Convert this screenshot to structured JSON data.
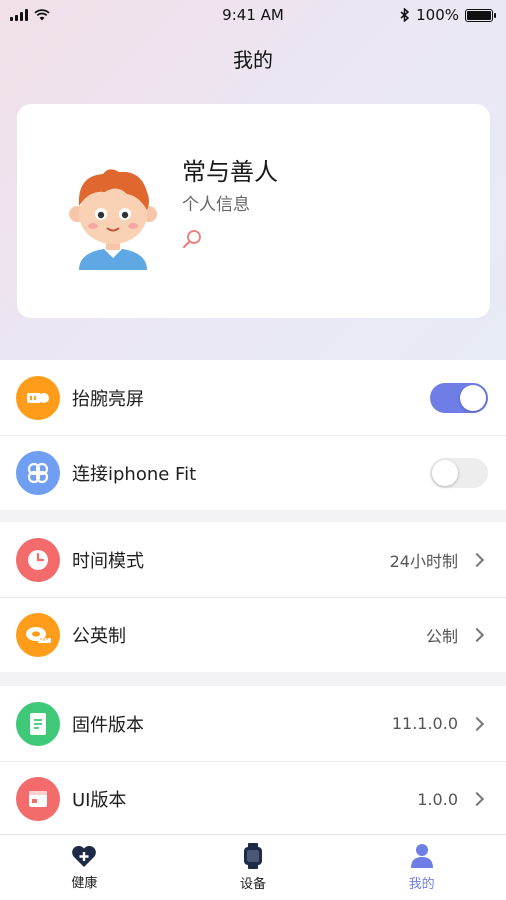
{
  "status_bar": {
    "time": "9:41 AM",
    "battery": "100%",
    "battery_level": 1.0
  },
  "page": {
    "title": "我的"
  },
  "profile": {
    "name": "常与善人",
    "subtitle": "个人信息",
    "avatar_icon": "cartoon-boy-avatar"
  },
  "settings": {
    "raise_wrist": {
      "label": "抬腕亮屏",
      "enabled": true,
      "icon": "watch-wake-icon",
      "color": "#ff9d1a"
    },
    "connect_fit": {
      "label": "连接iphone Fit",
      "enabled": false,
      "icon": "link-knot-icon",
      "color": "#6f9ef2"
    },
    "time_mode": {
      "label": "时间模式",
      "value": "24小时制",
      "icon": "clock-icon",
      "color": "#f46b6b"
    },
    "unit_system": {
      "label": "公英制",
      "value": "公制",
      "icon": "tape-measure-icon",
      "color": "#ff9d1a"
    },
    "firmware": {
      "label": "固件版本",
      "value": "11.1.0.0",
      "icon": "document-icon",
      "color": "#3ec878"
    },
    "ui_version": {
      "label": "UI版本",
      "value": "1.0.0",
      "icon": "window-icon",
      "color": "#f46b6b"
    }
  },
  "tabbar": {
    "items": [
      {
        "label": "健康",
        "icon": "heart-plus-icon",
        "active": false
      },
      {
        "label": "设备",
        "icon": "watch-icon",
        "active": false
      },
      {
        "label": "我的",
        "icon": "person-icon",
        "active": true
      }
    ],
    "active_color": "#6f7ee6"
  }
}
